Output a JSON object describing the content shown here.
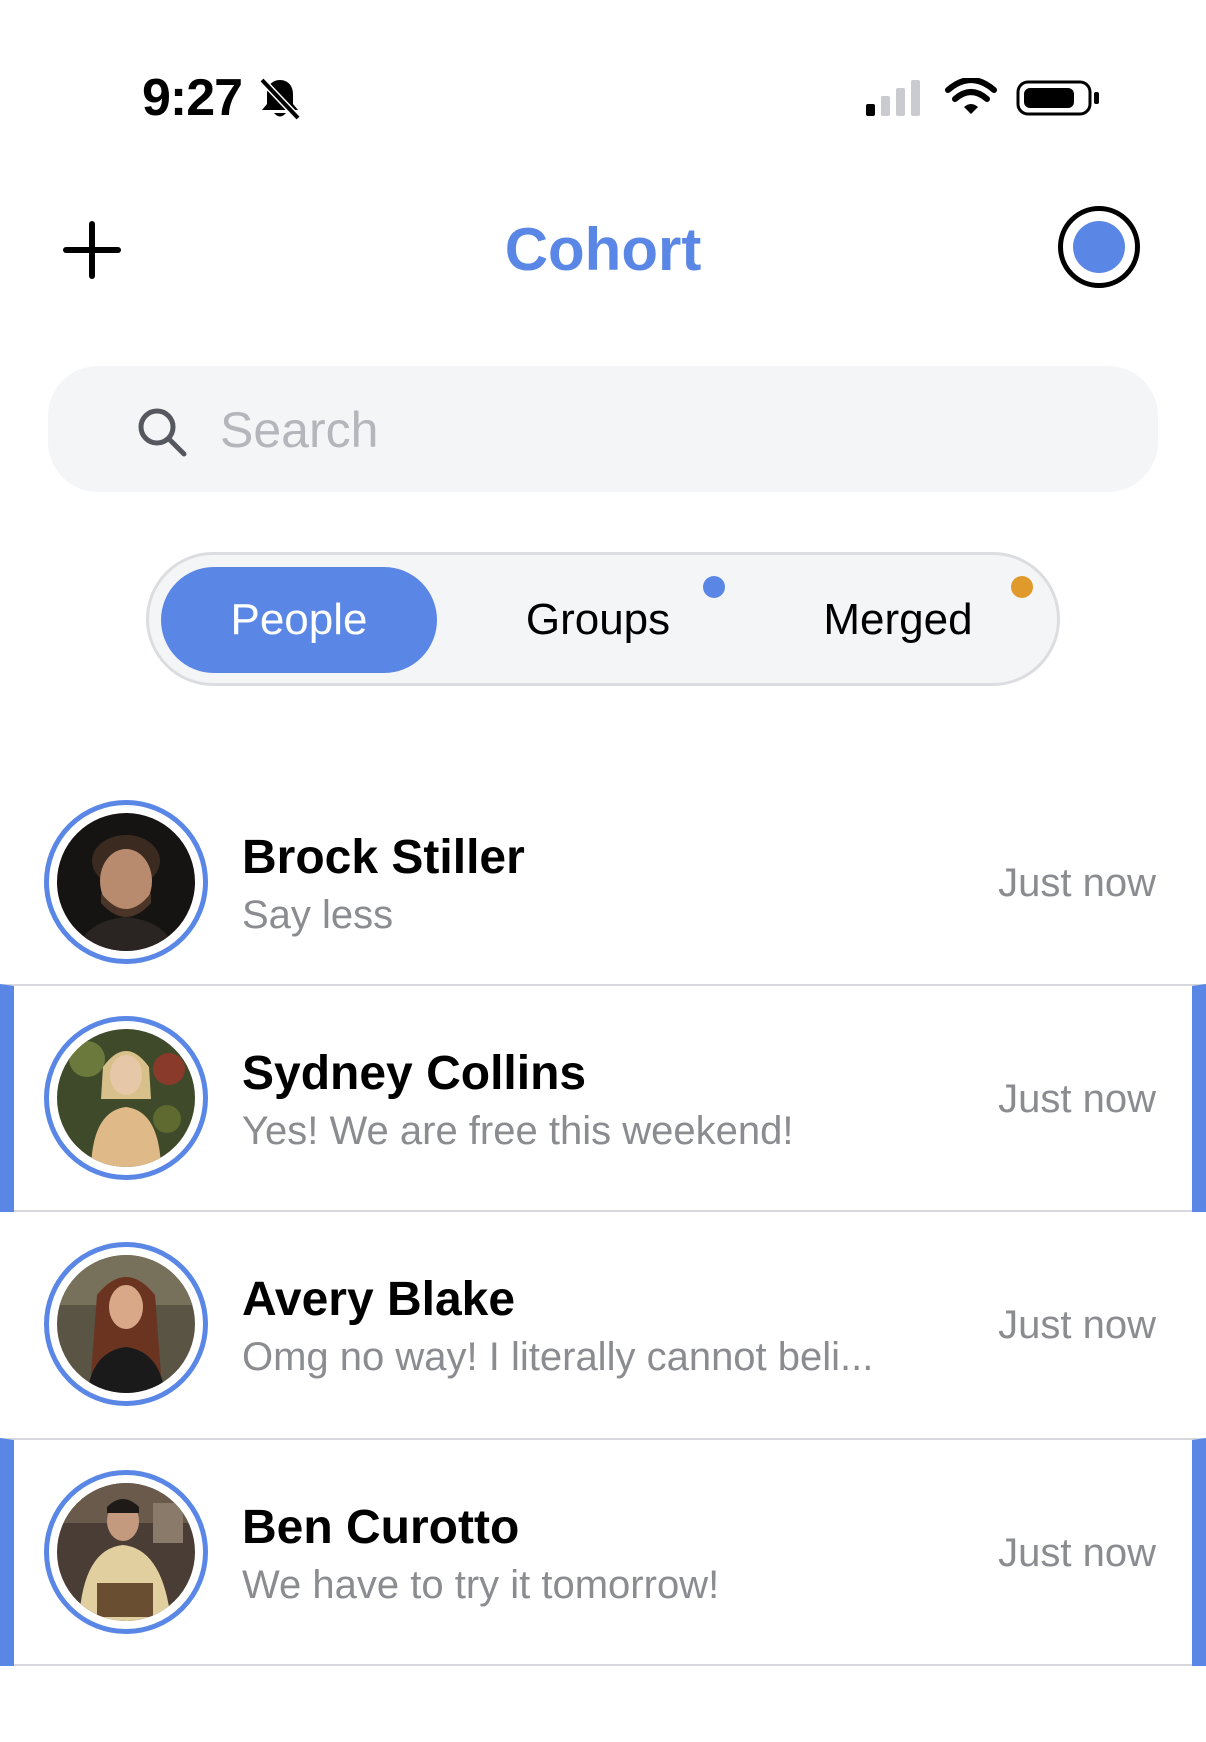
{
  "status_bar": {
    "time": "9:27",
    "icons": [
      "bell-slash-icon",
      "cellular-signal-icon",
      "wifi-icon",
      "battery-icon"
    ]
  },
  "header": {
    "title": "Cohort",
    "left_icon": "plus-icon",
    "right_icon": "profile-circle-icon"
  },
  "search": {
    "placeholder": "Search",
    "value": "",
    "icon": "search-icon"
  },
  "tabs": [
    {
      "label": "People",
      "active": true,
      "dot_color": null
    },
    {
      "label": "Groups",
      "active": false,
      "dot_color": "#5a87e6"
    },
    {
      "label": "Merged",
      "active": false,
      "dot_color": "#e09a2b"
    }
  ],
  "conversations": [
    {
      "name": "Brock Stiller",
      "preview": "Say less",
      "time": "Just now",
      "highlighted": false
    },
    {
      "name": "Sydney Collins",
      "preview": "Yes! We are free this weekend!",
      "time": "Just now",
      "highlighted": true
    },
    {
      "name": "Avery Blake",
      "preview": "Omg no way! I literally cannot beli...",
      "time": "Just now",
      "highlighted": false
    },
    {
      "name": "Ben Curotto",
      "preview": "We have to try it tomorrow!",
      "time": "Just now",
      "highlighted": true
    }
  ],
  "colors": {
    "accent": "#5a87e6",
    "merged_dot": "#e09a2b",
    "secondary_text": "#8a8c90",
    "divider": "#d6d8dc"
  }
}
